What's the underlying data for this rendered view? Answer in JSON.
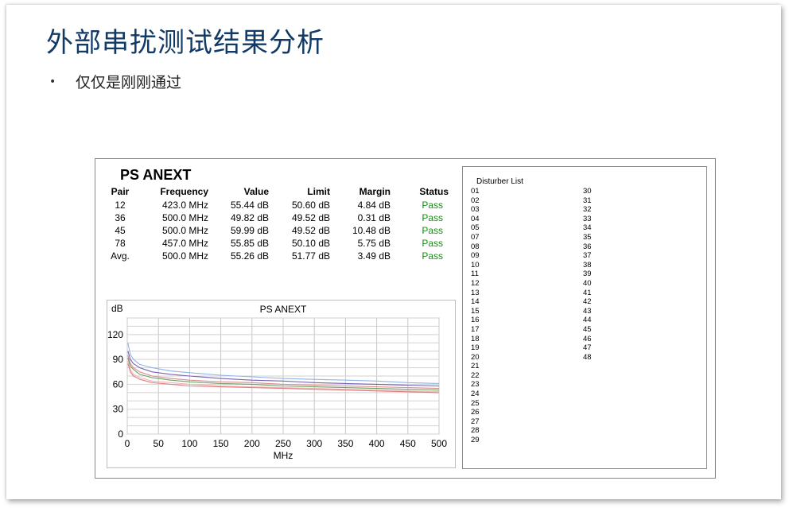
{
  "slide": {
    "title": "外部串扰测试结果分析",
    "bullet": "仅仅是刚刚通过"
  },
  "report": {
    "title": "PS ANEXT",
    "columns": [
      "Pair",
      "Frequency",
      "Value",
      "Limit",
      "Margin",
      "Status"
    ],
    "rows": [
      [
        "12",
        "423.0 MHz",
        "55.44 dB",
        "50.60 dB",
        "4.84 dB",
        "Pass"
      ],
      [
        "36",
        "500.0 MHz",
        "49.82 dB",
        "49.52 dB",
        "0.31 dB",
        "Pass"
      ],
      [
        "45",
        "500.0 MHz",
        "59.99 dB",
        "49.52 dB",
        "10.48 dB",
        "Pass"
      ],
      [
        "78",
        "457.0 MHz",
        "55.85 dB",
        "50.10 dB",
        "5.75 dB",
        "Pass"
      ],
      [
        "Avg.",
        "500.0 MHz",
        "55.26 dB",
        "51.77 dB",
        "3.49 dB",
        "Pass"
      ]
    ],
    "pass_color": "#1a8a1a"
  },
  "chart_data": {
    "type": "line",
    "title": "PS ANEXT",
    "xlabel": "MHz",
    "ylabel": "dB",
    "xlim": [
      0,
      500
    ],
    "ylim": [
      0,
      140
    ],
    "xticks": [
      0,
      50,
      100,
      150,
      200,
      250,
      300,
      350,
      400,
      450,
      500
    ],
    "yticks": [
      0,
      30,
      60,
      90,
      120
    ],
    "grid": true,
    "series": [
      {
        "color": "#8fb3e6",
        "x": [
          1,
          5,
          10,
          20,
          40,
          70,
          100,
          150,
          200,
          250,
          300,
          350,
          400,
          450,
          500
        ],
        "y": [
          110,
          96,
          90,
          84,
          80,
          76,
          74,
          71,
          69,
          67,
          66,
          65,
          64,
          62,
          61
        ]
      },
      {
        "color": "#7b5fb2",
        "x": [
          1,
          5,
          10,
          20,
          40,
          70,
          100,
          150,
          200,
          250,
          300,
          350,
          400,
          450,
          500
        ],
        "y": [
          100,
          90,
          85,
          80,
          75,
          72,
          70,
          67,
          65,
          64,
          62,
          61,
          60,
          59,
          58
        ]
      },
      {
        "color": "#d98c8c",
        "x": [
          1,
          5,
          10,
          20,
          40,
          70,
          100,
          150,
          200,
          250,
          300,
          350,
          400,
          450,
          500
        ],
        "y": [
          95,
          85,
          80,
          75,
          70,
          67,
          65,
          63,
          62,
          60,
          59,
          58,
          57,
          56,
          55
        ]
      },
      {
        "color": "#6aa06a",
        "x": [
          1,
          5,
          10,
          20,
          40,
          70,
          100,
          150,
          200,
          250,
          300,
          350,
          400,
          450,
          500
        ],
        "y": [
          92,
          82,
          78,
          72,
          68,
          65,
          63,
          61,
          60,
          58,
          57,
          56,
          55,
          54,
          53
        ]
      },
      {
        "color": "#f0b4b4",
        "x": [
          1,
          5,
          10,
          20,
          40,
          70,
          100,
          150,
          200,
          250,
          300,
          350,
          400,
          450,
          500
        ],
        "y": [
          88,
          78,
          72,
          68,
          64,
          62,
          60,
          58,
          57,
          56,
          55,
          54,
          53,
          52,
          51
        ]
      },
      {
        "color": "#e27f7f",
        "x": [
          1,
          5,
          10,
          20,
          40,
          70,
          100,
          150,
          200,
          250,
          300,
          350,
          400,
          450,
          500
        ],
        "y": [
          85,
          75,
          70,
          66,
          62,
          60,
          58,
          57,
          56,
          55,
          54,
          53,
          52,
          51,
          50
        ]
      }
    ]
  },
  "disturbers": {
    "title": "Disturber List",
    "col1": [
      "01",
      "02",
      "03",
      "04",
      "05",
      "07",
      "08",
      "09",
      "10",
      "11",
      "12",
      "13",
      "14",
      "15",
      "16",
      "17",
      "18",
      "19",
      "20",
      "21",
      "22",
      "23",
      "24",
      "25",
      "26",
      "27",
      "28",
      "29"
    ],
    "col2": [
      "30",
      "31",
      "32",
      "33",
      "34",
      "35",
      "36",
      "37",
      "38",
      "39",
      "40",
      "41",
      "42",
      "43",
      "44",
      "45",
      "46",
      "47",
      "48"
    ]
  }
}
